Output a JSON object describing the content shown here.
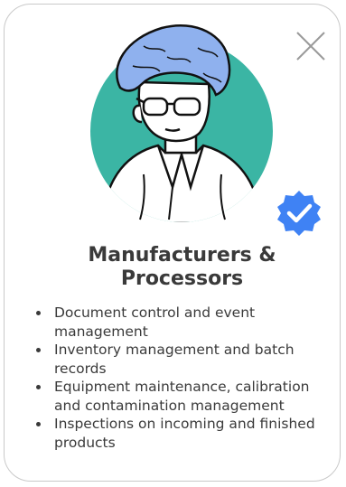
{
  "card": {
    "title": "Manufacturers & Processors",
    "features": [
      "Document control and event management",
      "Inventory management and batch records",
      "Equipment maintenance, calibration and contamination management",
      "Inspections on incoming and finished products"
    ],
    "avatar_icon": "worker-in-hairnet-illustration",
    "badge_icon": "verified-check-badge-icon",
    "close_icon": "close-x-icon"
  },
  "colors": {
    "avatar_circle": "#3bb5a4",
    "hairnet": "#8fb1ee",
    "badge": "#3f82f4",
    "text": "#3a3a3a",
    "border": "#c9c9c9"
  }
}
